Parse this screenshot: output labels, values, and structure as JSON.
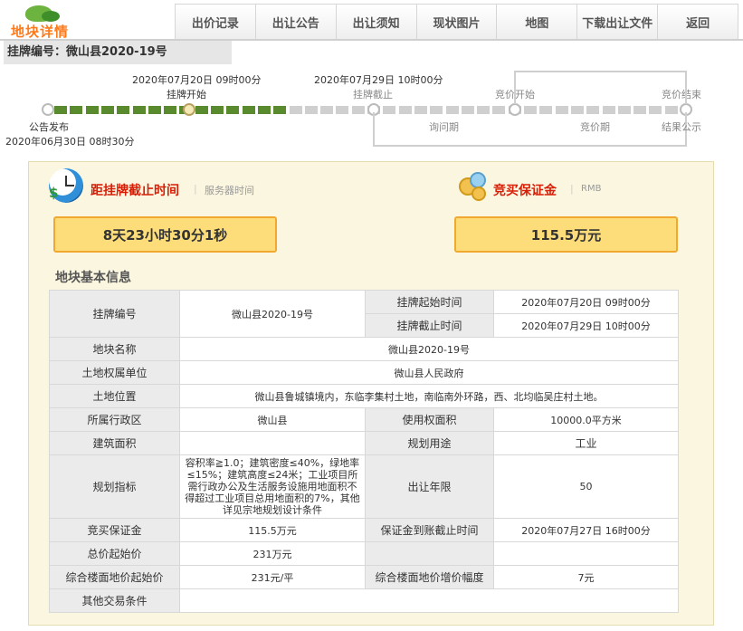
{
  "header": {
    "logo_text": "地块详情",
    "nav": [
      "出价记录",
      "出让公告",
      "出让须知",
      "现状图片",
      "地图",
      "下载出让文件",
      "返回"
    ]
  },
  "listing_title": "挂牌编号：微山县2020-19号",
  "timeline": {
    "announce_label": "公告发布",
    "announce_time": "2020年06月30日 08时30分",
    "start_time": "2020年07月20日 09时00分",
    "start_label": "挂牌开始",
    "end_time": "2020年07月29日 10时00分",
    "end_label": "挂牌截止",
    "bid_start_label": "竞价开始",
    "bid_end_label": "竞价结束",
    "inquiry_period": "询问期",
    "bid_period": "竞价期",
    "result_label": "结果公示",
    "progress": 0.37
  },
  "countdown": {
    "title": "距挂牌截止时间",
    "sub": "服务器时间",
    "value": "8天23小时30分1秒"
  },
  "deposit": {
    "title": "竞买保证金",
    "sub": "RMB",
    "value": "115.5万元"
  },
  "basic_info_title": "地块基本信息",
  "table": {
    "listing_no_label": "挂牌编号",
    "listing_no": "微山县2020-19号",
    "start_time_label": "挂牌起始时间",
    "start_time": "2020年07月20日 09时00分",
    "end_time_label": "挂牌截止时间",
    "end_time": "2020年07月29日 10时00分",
    "parcel_name_label": "地块名称",
    "parcel_name": "微山县2020-19号",
    "owner_label": "土地权属单位",
    "owner": "微山县人民政府",
    "location_label": "土地位置",
    "location": "微山县鲁城镇境内，东临李集村土地，南临南外环路，西、北均临吴庄村土地。",
    "district_label": "所属行政区",
    "district": "微山县",
    "area_label": "使用权面积",
    "area": "10000.0平方米",
    "building_area_label": "建筑面积",
    "building_area": "",
    "usage_label": "规划用途",
    "usage": "工业",
    "planning_label": "规划指标",
    "planning": "容积率≧1.0；建筑密度≤40%，绿地率≤15%；建筑高度≤24米；工业项目所需行政办公及生活服务设施用地面积不得超过工业项目总用地面积的7%，其他详见宗地规划设计条件",
    "term_label": "出让年限",
    "term": "50",
    "deposit_label": "竞买保证金",
    "deposit": "115.5万元",
    "deposit_deadline_label": "保证金到账截止时间",
    "deposit_deadline": "2020年07月27日 16时00分",
    "total_price_label": "总价起始价",
    "total_price": "231万元",
    "floor_price_label": "综合楼面地价起始价",
    "floor_price": "231元/平",
    "increment_label": "综合楼面地价增价幅度",
    "increment": "7元",
    "other_label": "其他交易条件",
    "other": ""
  },
  "colors": {
    "accent_red": "#d81e06",
    "progress_green": "#5a8a2e",
    "highlight_box": "#fddd7a"
  }
}
